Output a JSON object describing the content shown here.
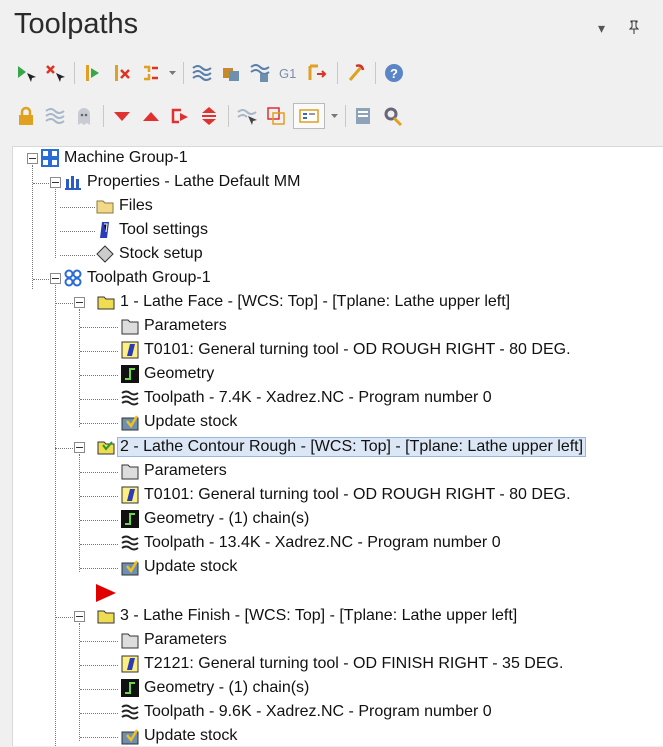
{
  "panel": {
    "title": "Toolpaths"
  },
  "window_controls": [
    {
      "name": "dropdown-arrow-icon",
      "glyph": "▼"
    },
    {
      "name": "pin-icon",
      "glyph": "📌"
    }
  ],
  "toolbar_row1": [
    "select-all-operations-icon",
    "select-all-dirty-icon",
    "regenerate-selected-icon",
    "regenerate-dirty-icon",
    "toggle-display-icon",
    "backplot-icon",
    "verify-icon",
    "simulate-icon",
    "post-gcode-icon",
    "post-selected-icon",
    "high-feed-icon",
    "help-icon"
  ],
  "toolbar_row2": [
    "lock-icon",
    "toggle-posting-icon",
    "hide-icon",
    "move-down-icon",
    "move-up-icon",
    "insert-after-icon",
    "scroll-to-insert-icon",
    "only-display-selected-icon",
    "display-options-icon",
    "toolpath-manager-options-icon",
    "settings-icon"
  ],
  "tree": {
    "machine_group": "Machine Group-1",
    "properties": "Properties - Lathe Default MM",
    "files": "Files",
    "tool_settings": "Tool settings",
    "stock_setup": "Stock setup",
    "toolpath_group": "Toolpath Group-1",
    "operations": [
      {
        "label": "1 - Lathe Face - [WCS: Top] - [Tplane: Lathe upper left]",
        "parameters": "Parameters",
        "tool": "T0101: General turning tool - OD ROUGH RIGHT - 80 DEG.",
        "geometry": "Geometry",
        "toolpath": "Toolpath - 7.4K - Xadrez.NC - Program number 0",
        "update_stock": "Update stock",
        "selected": false
      },
      {
        "label": "2 - Lathe Contour Rough - [WCS: Top] - [Tplane: Lathe upper left]",
        "parameters": "Parameters",
        "tool": "T0101: General turning tool - OD ROUGH RIGHT - 80 DEG.",
        "geometry": "Geometry - (1) chain(s)",
        "toolpath": "Toolpath - 13.4K - Xadrez.NC - Program number 0",
        "update_stock": "Update stock",
        "selected": true
      },
      {
        "label": "3 - Lathe Finish - [WCS: Top] - [Tplane: Lathe upper left]",
        "parameters": "Parameters",
        "tool": "T2121: General turning tool - OD FINISH RIGHT - 35 DEG.",
        "geometry": "Geometry - (1) chain(s)",
        "toolpath": "Toolpath - 9.6K - Xadrez.NC - Program number 0",
        "update_stock": "Update stock",
        "selected": false
      }
    ]
  },
  "colors": {
    "selection_bg": "#dce7f5",
    "insert_arrow": "#e00000",
    "tree_bg": "#ffffff"
  }
}
